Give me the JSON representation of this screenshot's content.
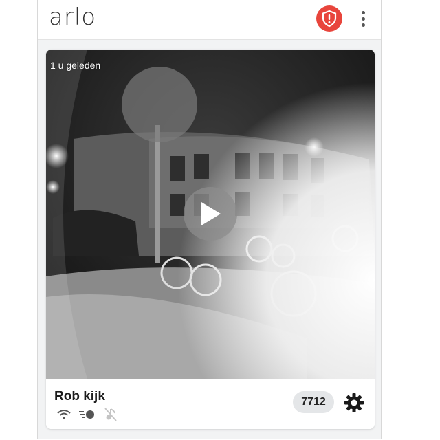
{
  "app": {
    "logo": "arlo"
  },
  "header": {
    "alert_icon": "shield-alert-icon",
    "menu_icon": "more-vertical-icon"
  },
  "camera_card": {
    "timestamp": "1 u geleden",
    "play_icon": "play-icon",
    "name": "Rob kijk",
    "status_icons": [
      "wifi-icon",
      "battery-motion-icon",
      "audio-off-icon"
    ],
    "badge": "7712",
    "settings_icon": "gear-icon"
  },
  "colors": {
    "alert": "#e8453c",
    "background": "#f2f3f4",
    "badge_bg": "#e4e6e8"
  }
}
